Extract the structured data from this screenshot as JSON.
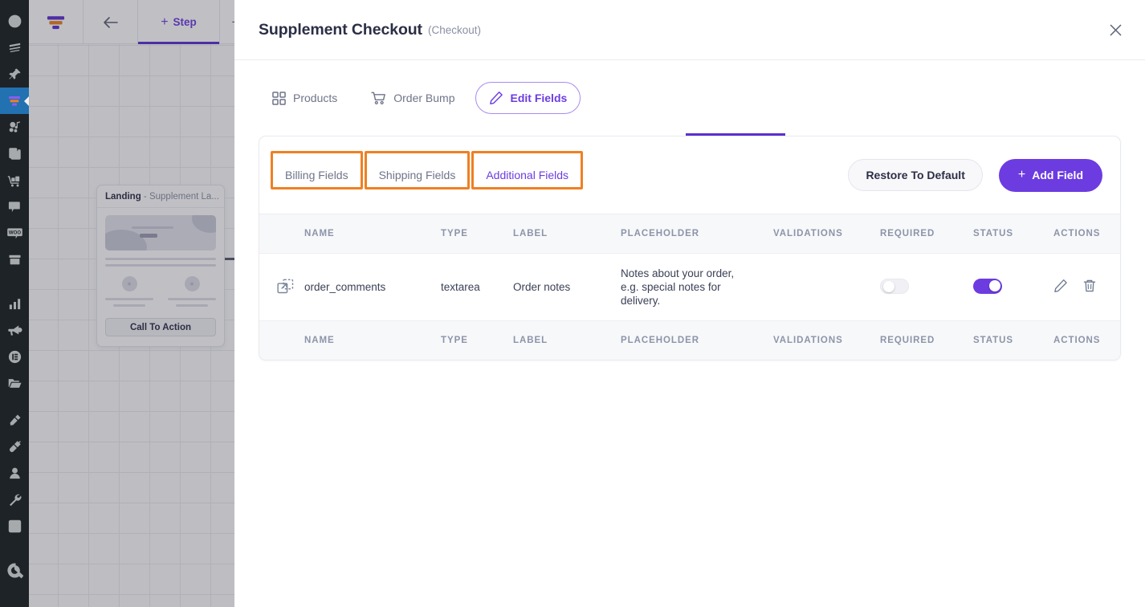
{
  "wp_sidebar": {
    "items": [
      {
        "name": "dashboard-icon",
        "label": "Dashboard",
        "active": false
      },
      {
        "name": "stack-icon",
        "label": "Templates",
        "active": false
      },
      {
        "name": "pin-icon",
        "label": "Pinned",
        "active": false
      },
      {
        "name": "funnel-icon",
        "label": "Funnels",
        "active": true
      },
      {
        "name": "media-icon",
        "label": "Media",
        "active": false
      },
      {
        "name": "pages-icon",
        "label": "Pages",
        "active": false
      },
      {
        "name": "cart-icon",
        "label": "Products",
        "active": false
      },
      {
        "name": "comment-icon",
        "label": "Comments",
        "active": false
      },
      {
        "name": "woo-icon",
        "label": "WooCommerce",
        "active": false
      },
      {
        "name": "archive-icon",
        "label": "Archive",
        "active": false
      },
      {
        "name": "analytics-icon",
        "label": "Analytics",
        "active": false
      },
      {
        "name": "megaphone-icon",
        "label": "Marketing",
        "active": false
      },
      {
        "name": "elementor-icon",
        "label": "Elementor",
        "active": false
      },
      {
        "name": "folder-icon",
        "label": "Files",
        "active": false
      },
      {
        "name": "brush-icon",
        "label": "Appearance",
        "active": false
      },
      {
        "name": "plugin-icon",
        "label": "Plugins",
        "active": false
      },
      {
        "name": "user-icon",
        "label": "Users",
        "active": false
      },
      {
        "name": "wrench-icon",
        "label": "Tools",
        "active": false
      },
      {
        "name": "settings-icon",
        "label": "Settings",
        "active": false
      },
      {
        "name": "q-logo-icon",
        "label": "Q",
        "active": false
      }
    ]
  },
  "topbar": {
    "logo_icon": "funnel-logo-icon",
    "back_icon": "arrow-left-icon",
    "step_plus": "+",
    "step_label": "Step",
    "add_label": "+"
  },
  "canvas": {
    "step_card": {
      "type": "Landing",
      "separator": "-",
      "name": "Supplement La...",
      "cta_label": "Call To Action"
    }
  },
  "modal": {
    "title": "Supplement Checkout",
    "subtitle": "(Checkout)",
    "close_icon": "close-icon",
    "tabs": [
      {
        "label": "Products",
        "icon": "grid-icon",
        "active": false
      },
      {
        "label": "Order Bump",
        "icon": "cart-icon",
        "active": false
      },
      {
        "label": "Edit Fields",
        "icon": "pencil-icon",
        "active": true
      }
    ],
    "field_groups": [
      {
        "label": "Billing Fields",
        "active": false,
        "annotated": true
      },
      {
        "label": "Shipping Fields",
        "active": false,
        "annotated": true
      },
      {
        "label": "Additional Fields",
        "active": true,
        "annotated": true
      }
    ],
    "restore_label": "Restore To Default",
    "add_field_plus": "+",
    "add_field_label": "Add Field",
    "table": {
      "columns": [
        "NAME",
        "TYPE",
        "LABEL",
        "PLACEHOLDER",
        "VALIDATIONS",
        "REQUIRED",
        "STATUS",
        "ACTIONS"
      ],
      "footer_columns": [
        "NAME",
        "TYPE",
        "LABEL",
        "PLACEHOLDER",
        "VALIDATIONS",
        "REQUIRED",
        "STATUS",
        "ACTIONS"
      ],
      "rows": [
        {
          "drag_icon": "move-icon",
          "name": "order_comments",
          "type": "textarea",
          "label": "Order notes",
          "placeholder": "Notes about your order, e.g. special notes for delivery.",
          "validations": "",
          "required": false,
          "status": true,
          "edit_icon": "pencil-icon",
          "delete_icon": "trash-icon"
        }
      ]
    }
  },
  "colors": {
    "accent_purple": "#6c3ce0",
    "annotation_orange": "#ef8023",
    "sidebar_dark": "#1d2327",
    "sidebar_active_blue": "#2271b1",
    "text_dark": "#2b2f45",
    "text_muted": "#8d94a8"
  }
}
